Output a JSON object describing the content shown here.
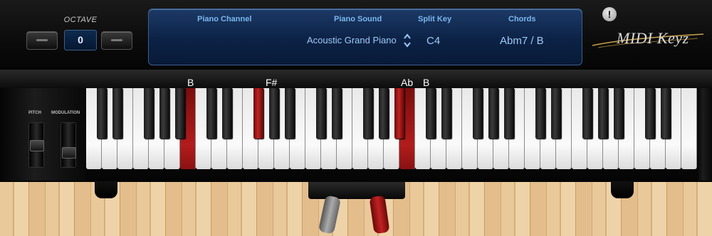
{
  "octave": {
    "label": "OCTAVE",
    "value": "0"
  },
  "info_panel": {
    "headers": {
      "piano_channel": "Piano Channel",
      "piano_sound": "Piano Sound",
      "split_key": "Split Key",
      "chords": "Chords"
    },
    "values": {
      "piano_channel": "",
      "piano_sound": "Acoustic Grand Piano",
      "split_key": "C4",
      "chords": "Abm7 / B"
    }
  },
  "logo": {
    "text": "MIDI Keyz"
  },
  "warning": {
    "symbol": "!"
  },
  "sliders": {
    "pitch_label": "PITCH",
    "modulation_label": "MODULATION"
  },
  "keyboard": {
    "pressed_notes": [
      "B",
      "F#",
      "Ab",
      "B"
    ]
  },
  "icons": {
    "stepper": "up-down-chevron-icon",
    "warning": "exclamation-icon"
  },
  "colors": {
    "pressed_key": "#b21c1c",
    "panel_text": "#9ccaf4",
    "panel_header": "#7ab7ee"
  }
}
